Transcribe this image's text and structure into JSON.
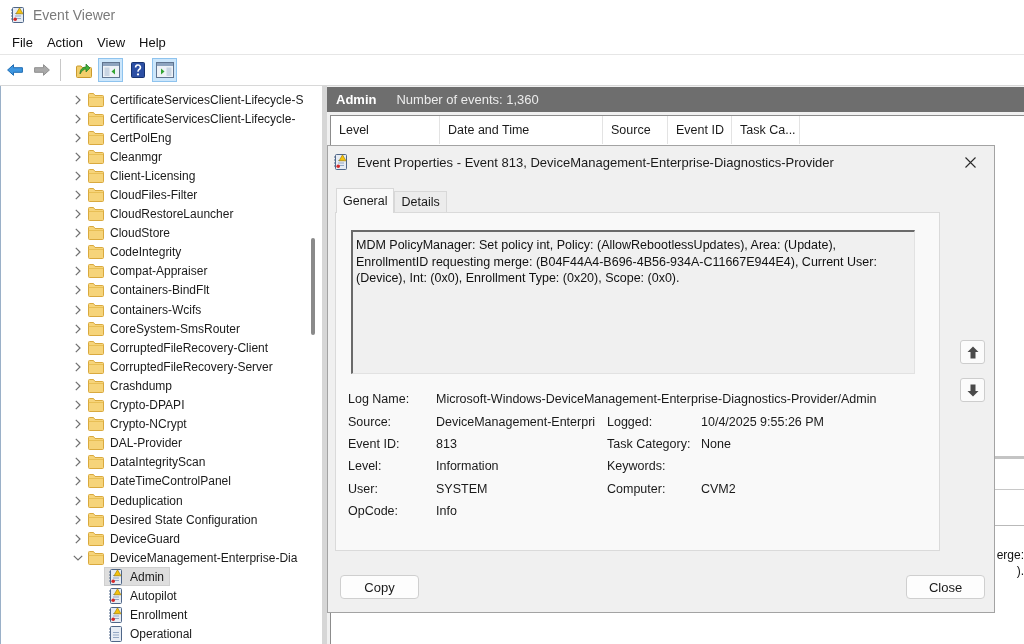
{
  "window": {
    "title": "Event Viewer"
  },
  "menu": [
    "File",
    "Action",
    "View",
    "Help"
  ],
  "toolbar": [
    [
      {
        "kind": "back",
        "disabled": false,
        "pressed": false
      },
      {
        "kind": "forward",
        "disabled": true,
        "pressed": false
      }
    ],
    [
      {
        "kind": "up-folder",
        "disabled": false,
        "pressed": false
      },
      {
        "kind": "console-tree",
        "disabled": false,
        "pressed": true
      },
      {
        "kind": "help",
        "disabled": false,
        "pressed": false
      },
      {
        "kind": "action-pane",
        "disabled": false,
        "pressed": true
      }
    ]
  ],
  "tree": {
    "items": [
      {
        "label": "CertificateServicesClient-Lifecycle-S",
        "expanded": false,
        "selected": false
      },
      {
        "label": "CertificateServicesClient-Lifecycle-",
        "expanded": false,
        "selected": false
      },
      {
        "label": "CertPolEng",
        "expanded": false,
        "selected": false
      },
      {
        "label": "Cleanmgr",
        "expanded": false,
        "selected": false
      },
      {
        "label": "Client-Licensing",
        "expanded": false,
        "selected": false
      },
      {
        "label": "CloudFiles-Filter",
        "expanded": false,
        "selected": false
      },
      {
        "label": "CloudRestoreLauncher",
        "expanded": false,
        "selected": false
      },
      {
        "label": "CloudStore",
        "expanded": false,
        "selected": false
      },
      {
        "label": "CodeIntegrity",
        "expanded": false,
        "selected": false
      },
      {
        "label": "Compat-Appraiser",
        "expanded": false,
        "selected": false
      },
      {
        "label": "Containers-BindFlt",
        "expanded": false,
        "selected": false
      },
      {
        "label": "Containers-Wcifs",
        "expanded": false,
        "selected": false
      },
      {
        "label": "CoreSystem-SmsRouter",
        "expanded": false,
        "selected": false
      },
      {
        "label": "CorruptedFileRecovery-Client",
        "expanded": false,
        "selected": false
      },
      {
        "label": "CorruptedFileRecovery-Server",
        "expanded": false,
        "selected": false
      },
      {
        "label": "Crashdump",
        "expanded": false,
        "selected": false
      },
      {
        "label": "Crypto-DPAPI",
        "expanded": false,
        "selected": false
      },
      {
        "label": "Crypto-NCrypt",
        "expanded": false,
        "selected": false
      },
      {
        "label": "DAL-Provider",
        "expanded": false,
        "selected": false
      },
      {
        "label": "DataIntegrityScan",
        "expanded": false,
        "selected": false
      },
      {
        "label": "DateTimeControlPanel",
        "expanded": false,
        "selected": false
      },
      {
        "label": "Deduplication",
        "expanded": false,
        "selected": false
      },
      {
        "label": "Desired State Configuration",
        "expanded": false,
        "selected": false
      },
      {
        "label": "DeviceGuard",
        "expanded": false,
        "selected": false
      },
      {
        "label": "DeviceManagement-Enterprise-Dia",
        "expanded": true,
        "selected": false,
        "children": [
          {
            "label": "Admin",
            "kind": "flagged",
            "selected": true
          },
          {
            "label": "Autopilot",
            "kind": "flagged",
            "selected": false
          },
          {
            "label": "Enrollment",
            "kind": "flagged",
            "selected": false
          },
          {
            "label": "Operational",
            "kind": "plain",
            "selected": false
          }
        ]
      }
    ]
  },
  "log_view": {
    "title": "Admin",
    "event_count": "Number of events: 1,360",
    "columns": [
      "Level",
      "Date and Time",
      "Source",
      "Event ID",
      "Task Ca..."
    ],
    "preview_text": [
      "erge:",
      ")."
    ]
  },
  "dialog": {
    "title": "Event Properties - Event 813, DeviceManagement-Enterprise-Diagnostics-Provider",
    "tabs": [
      {
        "label": "General",
        "selected": true
      },
      {
        "label": "Details",
        "selected": false
      }
    ],
    "description": "MDM PolicyManager: Set policy int, Policy: (AllowRebootlessUpdates), Area: (Update), EnrollmentID requesting merge: (B04F44A4-B696-4B56-934A-C11667E944E4), Current User: (Device), Int: (0x0), Enrollment Type: (0x20), Scope: (0x0).",
    "log_name": {
      "label": "Log Name:",
      "value": "Microsoft-Windows-DeviceManagement-Enterprise-Diagnostics-Provider/Admin"
    },
    "fields": [
      {
        "left": {
          "label": "Source:",
          "value": "DeviceManagement-Enterpri"
        },
        "right": {
          "label": "Logged:",
          "value": "10/4/2025 9:55:26 PM"
        }
      },
      {
        "left": {
          "label": "Event ID:",
          "value": "813"
        },
        "right": {
          "label": "Task Category:",
          "value": "None"
        }
      },
      {
        "left": {
          "label": "Level:",
          "value": "Information"
        },
        "right": {
          "label": "Keywords:"
        }
      },
      {
        "left": {
          "label": "User:",
          "value": "SYSTEM"
        },
        "right": {
          "label": "Computer:",
          "value": "CVM2"
        }
      },
      {
        "left": {
          "label": "OpCode:",
          "value": "Info"
        }
      }
    ],
    "buttons": [
      "Copy",
      "Close"
    ]
  }
}
